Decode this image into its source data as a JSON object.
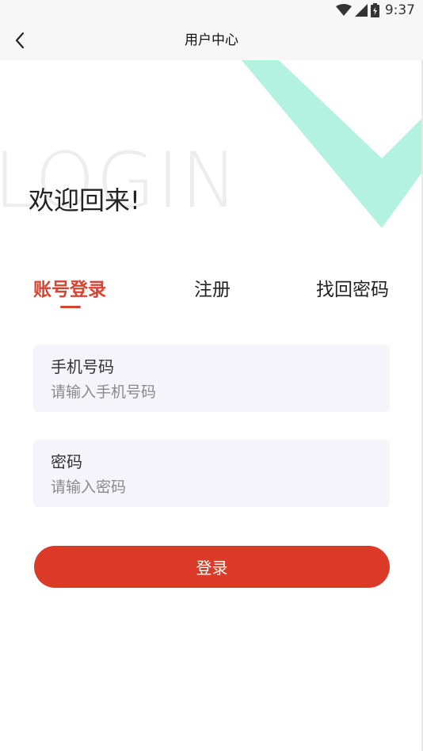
{
  "status_bar": {
    "time": "9:37",
    "icons": [
      "wifi-icon",
      "signal-icon",
      "battery-icon"
    ]
  },
  "nav": {
    "title": "用户中心",
    "back_icon": "chevron-left-icon"
  },
  "hero": {
    "watermark": "LOGIN",
    "welcome": "欢迎回来!"
  },
  "tabs": [
    {
      "label": "账号登录",
      "active": true
    },
    {
      "label": "注册",
      "active": false
    },
    {
      "label": "找回密码",
      "active": false
    }
  ],
  "form": {
    "phone": {
      "label": "手机号码",
      "placeholder": "请输入手机号码",
      "value": ""
    },
    "password": {
      "label": "密码",
      "placeholder": "请输入密码",
      "value": ""
    },
    "submit_label": "登录"
  },
  "colors": {
    "accent": "#d94230",
    "button": "#dc3a28",
    "deco": "#b2f2df",
    "field_bg": "#f5f4fb",
    "bar_bg": "#f7f7f7"
  }
}
